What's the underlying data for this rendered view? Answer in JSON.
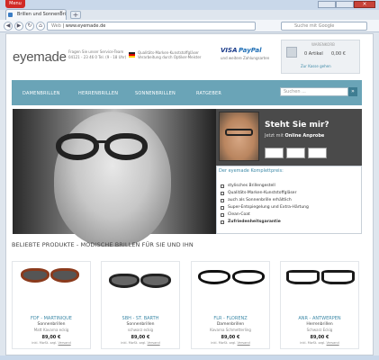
{
  "browser": {
    "menu_label": "Menu",
    "tab_title": "Brillen und Sonnenbrill...",
    "tab_close": "×",
    "new_tab": "+",
    "url_label": "Web",
    "url": "www.eyemade.de",
    "search_placeholder": "Suche mit Google",
    "back": "◀",
    "forward": "▶",
    "reload": "↻",
    "home": "⌂"
  },
  "header": {
    "logo": "eyemade",
    "service_line1": "Fragen Sie unser Service-Team",
    "service_line2": "04121 - 23 46 0 Tel. (9 - 18 Uhr)",
    "quality_line1": "Qualitäts-Marken-Kunststoffgläser",
    "quality_line2": "Verarbeitung durch Optiker-Meister",
    "visa": "VISA",
    "paypal": "PayPal",
    "payment_sub": "und weitere Zahlungsarten",
    "cart_label": "WARENKORB",
    "cart_items": "0 Artikel",
    "cart_total": "0,00 €",
    "cart_link": "Zur Kasse gehen"
  },
  "nav": {
    "items": [
      "DAMENBRILLEN",
      "HERRENBRILLEN",
      "SONNENBRILLEN",
      "RATGEBER"
    ],
    "search_placeholder": "Suchen ...",
    "search_button": "»"
  },
  "tryon": {
    "title": "Steht Sie mir?",
    "subtitle_prefix": "Jetzt mit ",
    "subtitle_bold": "Online Anprobe"
  },
  "usp": {
    "title": "Der eyemade Komplettpreis:",
    "items": [
      "stylisches Brillengestell",
      "Qualitäts-Marken-Kunststoffgläser",
      "auch als Sonnenbrille erhältlich",
      "Super-Entspiegelung und Extra-Härtung",
      "Clean-Coat",
      "Zufriedenheitsgarantie"
    ]
  },
  "products": {
    "heading": "BELIEBTE PRODUKTE - MODISCHE BRILLEN FÜR SIE UND IHN",
    "items": [
      {
        "name": "FDF - MARTINIQUE",
        "category": "Sonnenbrillen",
        "desc": "Matt Kavarna eckig",
        "price": "89,00 €",
        "vat": "inkl. MwSt. zzgl. ",
        "shipping": "Versand",
        "frame": "#8a3a1c",
        "lens": "#555"
      },
      {
        "name": "SBH - ST. BARTH",
        "category": "Sonnenbrillen",
        "desc": "schwarz eckig",
        "price": "89,00 €",
        "vat": "inkl. MwSt. zzgl. ",
        "shipping": "Versand",
        "frame": "#222",
        "lens": "#666"
      },
      {
        "name": "FLR - FLORENZ",
        "category": "Damenbrillen",
        "desc": "Kavarna Schmetterling",
        "price": "89,00 €",
        "vat": "inkl. MwSt. zzgl. ",
        "shipping": "Versand",
        "frame": "#111",
        "lens": "transparent"
      },
      {
        "name": "ANR - ANTWERPEN",
        "category": "Herrenbrillen",
        "desc": "Schwarz Eckig",
        "price": "89,00 €",
        "vat": "inkl. MwSt. zzgl. ",
        "shipping": "Versand",
        "frame": "#1a1a1a",
        "lens": "transparent"
      }
    ]
  },
  "colors": {
    "accent": "#6aa4b7",
    "link": "#3e8aa8"
  }
}
